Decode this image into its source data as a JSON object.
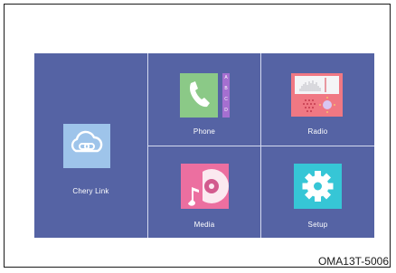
{
  "tiles": {
    "chery_link": {
      "label": "Chery Link",
      "icon": "chain-link-cloud-icon",
      "color": "#9ec4ea"
    },
    "phone": {
      "label": "Phone",
      "icon": "phone-icon",
      "color": "#8bc987",
      "index_letters": [
        "A",
        "B",
        "C",
        "D"
      ]
    },
    "radio": {
      "label": "Radio",
      "icon": "radio-icon",
      "color": "#f07883"
    },
    "media": {
      "label": "Media",
      "icon": "media-disc-icon",
      "color": "#ec6fa0"
    },
    "setup": {
      "label": "Setup",
      "icon": "gear-icon",
      "color": "#36c6d6"
    }
  },
  "caption": "OMA13T-5006",
  "colors": {
    "screen_background": "#5563a4",
    "divider": "#d4daf0",
    "label_text": "#ffffff",
    "index_tab": "#a56fd0"
  }
}
